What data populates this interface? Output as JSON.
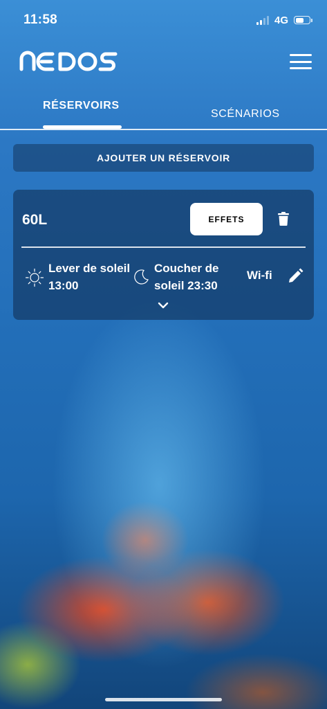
{
  "status_bar": {
    "time": "11:58",
    "network": "4G"
  },
  "header": {
    "logo_text": "NEDOS",
    "menu_icon": "hamburger-menu-icon"
  },
  "tabs": [
    {
      "label": "RÉSERVOIRS",
      "active": true
    },
    {
      "label": "SCÉNARIOS",
      "active": false
    }
  ],
  "add_button": {
    "label": "AJOUTER UN RÉSERVOIR"
  },
  "tank_card": {
    "name": "60L",
    "effects_label": "EFFETS",
    "sunrise": {
      "label": "Lever de soleil 13:00",
      "icon": "sun-icon"
    },
    "sunset": {
      "label": "Coucher de soleil 23:30",
      "icon": "moon-icon"
    },
    "connection": "Wi-fi"
  },
  "colors": {
    "accent": "#ffffff",
    "background_top": "#3b8fd6",
    "background_bottom": "#12457a",
    "card": "#12325a"
  }
}
